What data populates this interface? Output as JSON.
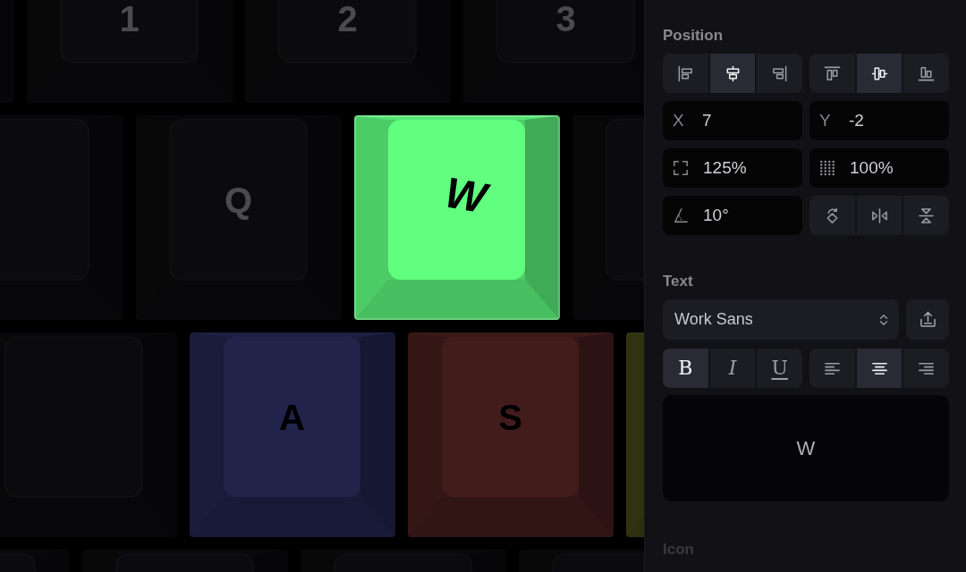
{
  "keyboard": {
    "rows": [
      {
        "keys": [
          {
            "selected": false
          },
          {
            "label": "1",
            "selected": false
          },
          {
            "label": "2",
            "selected": false
          },
          {
            "label": "3",
            "selected": false
          }
        ]
      },
      {
        "keys": [
          {
            "selected": false
          },
          {
            "label": "Q",
            "selected": false
          },
          {
            "label": "W",
            "color": "#60ff80",
            "selected": true
          },
          {
            "selected": false
          }
        ]
      },
      {
        "keys": [
          {
            "selected": false
          },
          {
            "label": "A",
            "color": "#21234b",
            "selected": false
          },
          {
            "label": "S",
            "color": "#421c1b",
            "selected": false
          },
          {
            "color": "#3c3f15",
            "selected": false
          }
        ]
      },
      {
        "keys": [
          {
            "selected": false
          },
          {
            "selected": false
          },
          {
            "selected": false
          },
          {
            "selected": false
          }
        ]
      }
    ]
  },
  "panel": {
    "position": {
      "title": "Position",
      "horizontal_align": [
        {
          "kind": "left",
          "selected": false
        },
        {
          "kind": "center",
          "selected": true
        },
        {
          "kind": "right",
          "selected": false
        }
      ],
      "vertical_align": [
        {
          "kind": "top",
          "selected": false
        },
        {
          "kind": "middle",
          "selected": true
        },
        {
          "kind": "bottom",
          "selected": false
        }
      ],
      "offset_x": {
        "label": "X",
        "value": "7"
      },
      "offset_y": {
        "label": "Y",
        "value": "-2"
      },
      "size": {
        "value": "125%"
      },
      "opacity": {
        "value": "100%"
      },
      "angle": {
        "value": "10°"
      },
      "transform_buttons": [
        {
          "kind": "rotate"
        },
        {
          "kind": "flip-horizontal"
        },
        {
          "kind": "flip-vertical"
        }
      ]
    },
    "text": {
      "title": "Text",
      "font": "Work Sans",
      "style_buttons": [
        {
          "kind": "bold",
          "label": "B",
          "selected": true
        },
        {
          "kind": "italic",
          "label": "I",
          "selected": false
        },
        {
          "kind": "underline",
          "label": "U",
          "selected": false
        }
      ],
      "align_buttons": [
        {
          "kind": "left",
          "selected": false
        },
        {
          "kind": "center",
          "selected": true
        },
        {
          "kind": "right",
          "selected": false
        }
      ],
      "content": "W"
    },
    "icon": {
      "title": "Icon"
    }
  }
}
